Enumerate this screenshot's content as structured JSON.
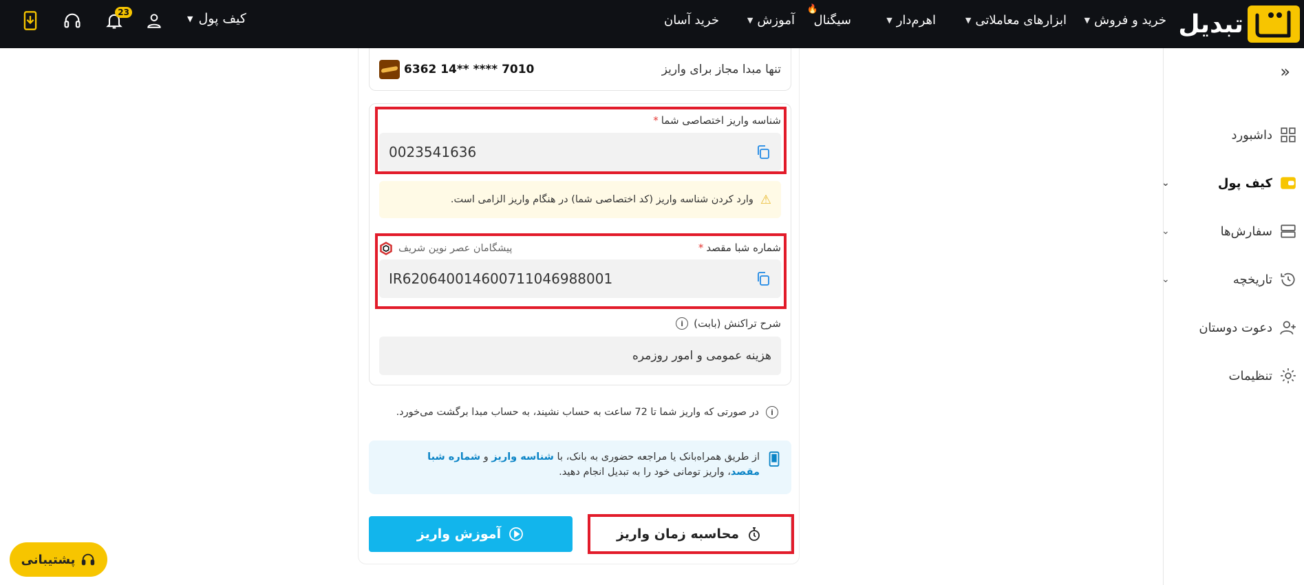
{
  "brand": {
    "name": "تبدیل"
  },
  "nav": {
    "buy_sell": "خرید و فروش",
    "trading_tools": "ابزارهای معاملاتی",
    "leverage": "اهرم‌دار",
    "signal": "سیگنال",
    "education": "آموزش",
    "easy_buy": "خرید آسان"
  },
  "topbar": {
    "wallet_label": "کیف پول",
    "notification_count": "23"
  },
  "sidebar": {
    "items": [
      {
        "label": "داشبورد"
      },
      {
        "label": "کیف پول"
      },
      {
        "label": "سفارش‌ها"
      },
      {
        "label": "تاریخچه"
      },
      {
        "label": "دعوت دوستان"
      },
      {
        "label": "تنظیمات"
      }
    ]
  },
  "origin": {
    "label": "تنها مبدا مجاز برای واریز",
    "card_number": "6362 14** **** 7010"
  },
  "deposit_id": {
    "label": "شناسه واریز اختصاصی شما",
    "required_mark": "*",
    "value": "0023541636"
  },
  "warning": {
    "text": "وارد کردن شناسه واریز (کد اختصاصی شما) در هنگام واریز الزامی است."
  },
  "iban": {
    "label": "شماره شبا مقصد",
    "required_mark": "*",
    "bank_name": "پیشگامان عصر نوین شریف",
    "value": "IR620640014600711046988001"
  },
  "description": {
    "label": "شرح تراکنش (بابت)",
    "value": "هزینه عمومی و امور روزمره"
  },
  "note": {
    "text": "در صورتی که واریز شما تا 72 ساعت به حساب نشیند، به حساب مبدا برگشت می‌خورد."
  },
  "mobile_info": {
    "part1": "از طریق همراه‌بانک یا مراجعه حضوری به بانک، با ",
    "hl1": "شناسه واریز",
    "part2": " و ",
    "hl2": "شماره شبا مقصد",
    "part3": "، واریز تومانی خود را به تبدیل انجام دهید."
  },
  "buttons": {
    "calc_time": "محاسبه زمان واریز",
    "tutorial": "آموزش واریز"
  },
  "support": {
    "label": "پشتیبانی"
  },
  "colors": {
    "accent": "#f7c500",
    "primary": "#12b5ec",
    "highlight_border": "#e21b2a"
  }
}
